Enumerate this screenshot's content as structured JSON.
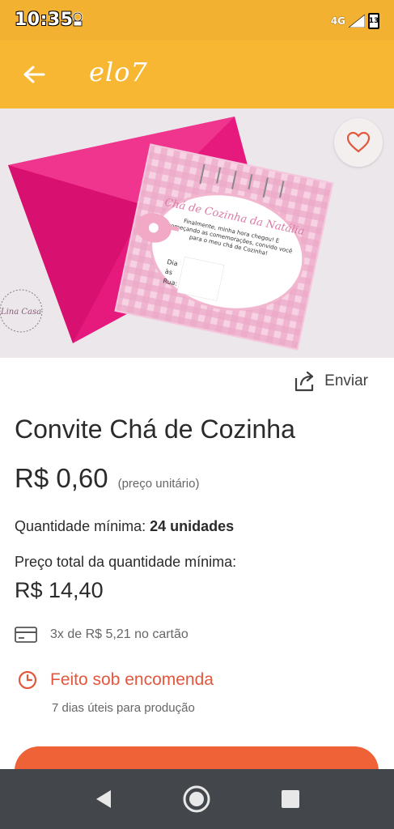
{
  "status_bar": {
    "time": "10:35",
    "network": "4G",
    "battery": "13"
  },
  "app_bar": {
    "brand": "elo7",
    "background": "#f7b733"
  },
  "product_image": {
    "invitation_heading": "Chá de Cozinha da Natália",
    "invitation_body": "Finalmente, minha hora chegou! E começando as comemorações, convido você para o meu chá de Cozinha!",
    "field_day": "Dia",
    "field_time": "às",
    "field_street": "Rua:",
    "watermark": "Lina Casa"
  },
  "product": {
    "share_label": "Enviar",
    "title": "Convite Chá de Cozinha",
    "price": "R$ 0,60",
    "price_note": "(preço unitário)",
    "min_qty_label": "Quantidade mínima:",
    "min_qty_value": "24 unidades",
    "total_label": "Preço total da quantidade mínima:",
    "total_price": "R$ 14,40",
    "installments": "3x de R$ 5,21 no cartão",
    "made_to_order": "Feito sob encomenda",
    "production_time": "7 dias úteis para produção"
  },
  "colors": {
    "accent": "#ef6137",
    "status_bar": "#f2b131",
    "nav_bar": "#43474b"
  }
}
